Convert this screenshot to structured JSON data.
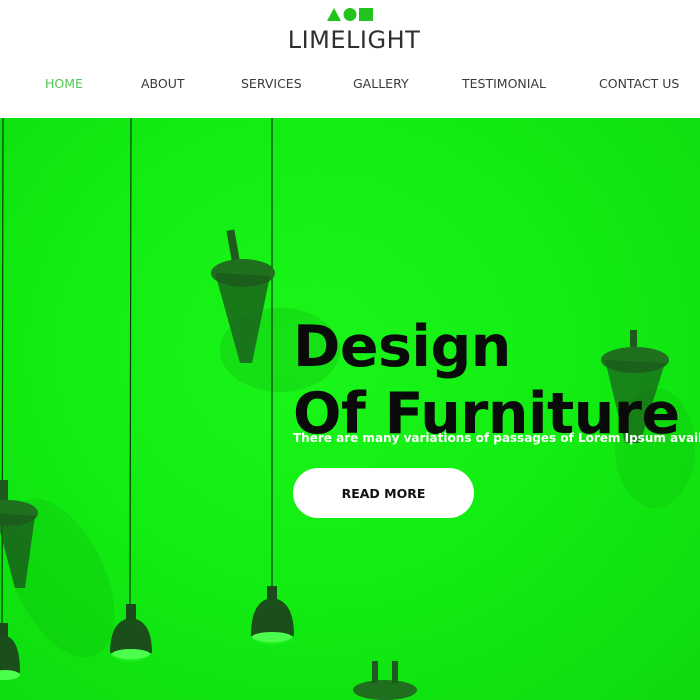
{
  "brand": {
    "name": "LIMELIGHT",
    "logo_icon": "triangle-circle-square-icon",
    "accent_color": "#22c21f"
  },
  "nav": {
    "items": [
      {
        "label": "HOME",
        "active": true
      },
      {
        "label": "ABOUT",
        "active": false
      },
      {
        "label": "SERVICES",
        "active": false
      },
      {
        "label": "GALLERY",
        "active": false
      },
      {
        "label": "TESTIMONIAL",
        "active": false
      },
      {
        "label": "CONTACT US",
        "active": false
      }
    ],
    "active_color": "#4ecb52",
    "text_color": "#3a3a3a"
  },
  "hero": {
    "title_line1": "Design",
    "title_line2": "Of Furniture",
    "subtitle": "There are many variations of passages of Lorem Ipsum availab",
    "button_label": "READ MORE",
    "background_color": "#12ee12",
    "image": "hanging-lamps-photo"
  }
}
